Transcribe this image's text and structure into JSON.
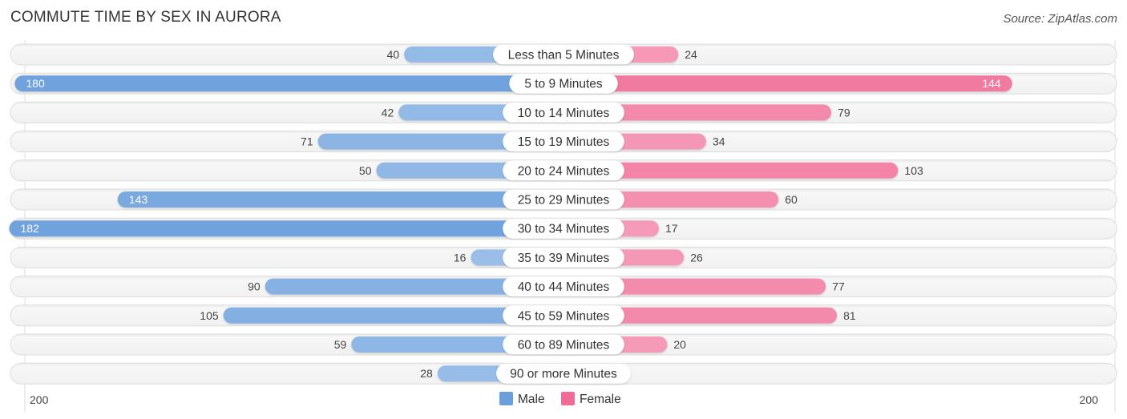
{
  "title": "COMMUTE TIME BY SEX IN AURORA",
  "source": "Source: ZipAtlas.com",
  "chart_data": {
    "type": "bar",
    "orientation": "horizontal-diverging",
    "title": "COMMUTE TIME BY SEX IN AURORA",
    "categories": [
      "Less than 5 Minutes",
      "5 to 9 Minutes",
      "10 to 14 Minutes",
      "15 to 19 Minutes",
      "20 to 24 Minutes",
      "25 to 29 Minutes",
      "30 to 34 Minutes",
      "35 to 39 Minutes",
      "40 to 44 Minutes",
      "45 to 59 Minutes",
      "60 to 89 Minutes",
      "90 or more Minutes"
    ],
    "series": [
      {
        "name": "Male",
        "color": "#6a9fdc",
        "values": [
          40,
          180,
          42,
          71,
          50,
          143,
          182,
          16,
          90,
          105,
          59,
          28
        ]
      },
      {
        "name": "Female",
        "color": "#f06b96",
        "values": [
          24,
          144,
          79,
          34,
          103,
          60,
          17,
          26,
          77,
          81,
          20,
          0
        ]
      }
    ],
    "axis": {
      "left_label": "200",
      "right_label": "200",
      "range": [
        -200,
        200
      ]
    },
    "legend": {
      "position": "bottom-center",
      "items": [
        "Male",
        "Female"
      ]
    }
  }
}
